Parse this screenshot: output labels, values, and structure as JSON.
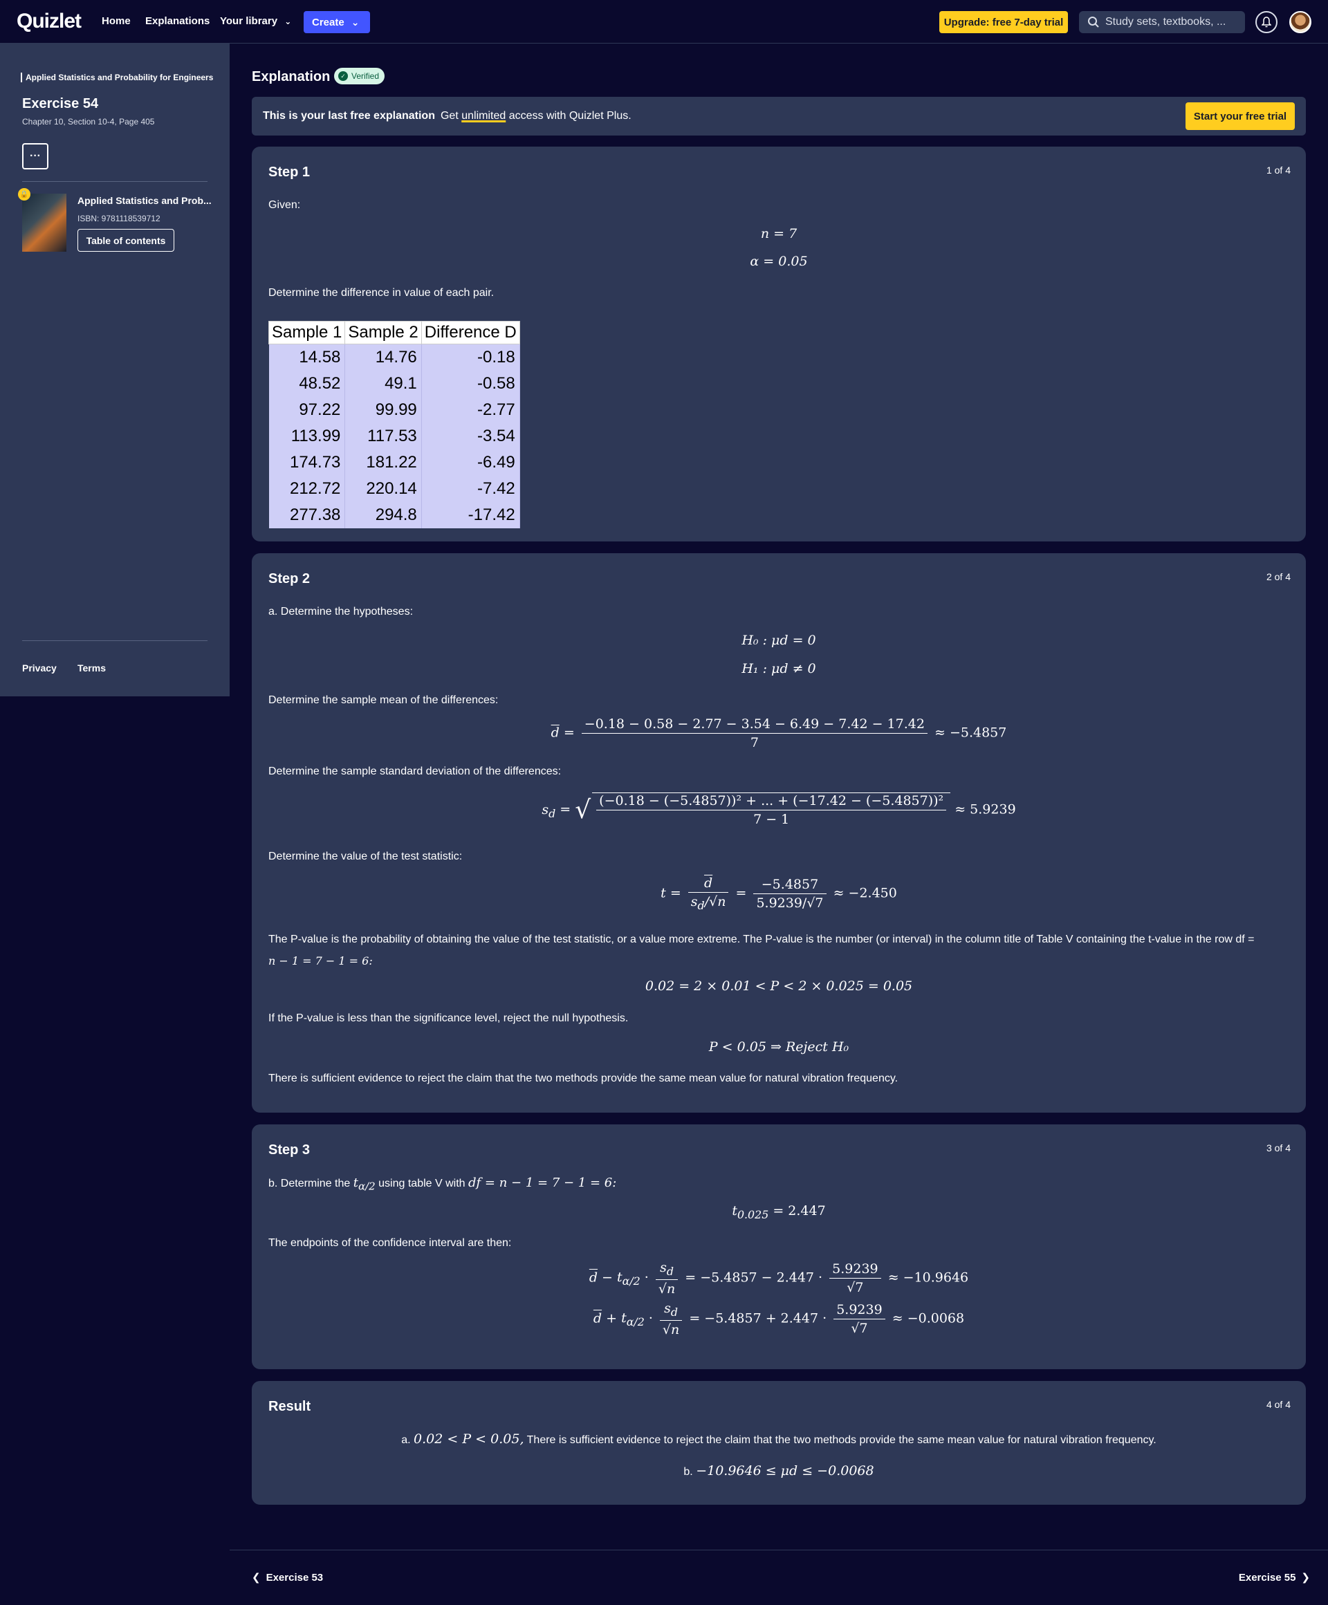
{
  "topbar": {
    "logo": "Quizlet",
    "nav": [
      "Home",
      "Explanations",
      "Your library"
    ],
    "create": "Create",
    "upgrade": "Upgrade: free 7-day trial",
    "search_placeholder": "Study sets, textbooks, ..."
  },
  "sidebar": {
    "book": "Applied Statistics and Probability for Engineers",
    "exercise": "Exercise 54",
    "chapter": "Chapter 10, Section 10-4, Page 405",
    "more": "···",
    "book_short": "Applied Statistics and Prob...",
    "isbn": "ISBN: 9781118539712",
    "toc": "Table of contents",
    "privacy": "Privacy",
    "terms": "Terms"
  },
  "main": {
    "title": "Explanation",
    "verified": "Verified",
    "banner_bold": "This is your last free explanation",
    "banner_pre": "Get",
    "banner_under": "unlimited",
    "banner_post": "access with Quizlet Plus.",
    "trial": "Start your free trial"
  },
  "step1": {
    "title": "Step 1",
    "count": "1 of 4",
    "given": "Given:",
    "n": "n = 7",
    "alpha": "α = 0.05",
    "determine": "Determine the difference in value of each pair.",
    "headers": [
      "Sample 1",
      "Sample 2",
      "Difference D"
    ],
    "rows": [
      [
        "14.58",
        "14.76",
        "-0.18"
      ],
      [
        "48.52",
        "49.1",
        "-0.58"
      ],
      [
        "97.22",
        "99.99",
        "-2.77"
      ],
      [
        "113.99",
        "117.53",
        "-3.54"
      ],
      [
        "174.73",
        "181.22",
        "-6.49"
      ],
      [
        "212.72",
        "220.14",
        "-7.42"
      ],
      [
        "277.38",
        "294.8",
        "-17.42"
      ]
    ]
  },
  "step2": {
    "title": "Step 2",
    "count": "2 of 4",
    "a": "a. Determine the hypotheses:",
    "h0": "H₀ : μd = 0",
    "h1": "H₁ : μd ≠ 0",
    "mean_text": "Determine the sample mean of the differences:",
    "mean_num": "−0.18 − 0.58 − 2.77 − 3.54 − 6.49 − 7.42 − 17.42",
    "mean_den": "7",
    "mean_res": "≈ −5.4857",
    "sd_text": "Determine the sample standard deviation of the differences:",
    "sd_num": "(−0.18 − (−5.4857))² + ... + (−17.42 − (−5.4857))²",
    "sd_den": "7 − 1",
    "sd_res": "≈ 5.9239",
    "t_text": "Determine the value of the test statistic:",
    "t_num2": "−5.4857",
    "t_den2": "5.9239/√7",
    "t_res": "≈ −2.450",
    "p_text1": "The P-value is the probability of obtaining the value of the test statistic, or a value more extreme. The P-value is the number (or interval) in the column title of Table V containing the t-value in the row df =",
    "p_text2": "n − 1 = 7 − 1 = 6:",
    "p_eq": "0.02 = 2 × 0.01 < P < 2 × 0.025 = 0.05",
    "reject_text": "If the P-value is less than the significance level, reject the null hypothesis.",
    "reject_eq": "P < 0.05 ⇒  Reject H₀",
    "conclusion": "There is sufficient evidence to reject the claim that the two methods provide the same mean value for natural vibration frequency."
  },
  "step3": {
    "title": "Step 3",
    "count": "3 of 4",
    "b_pre": "b. Determine the",
    "b_mid": "using table V with",
    "b_post": "df = n − 1 = 7 − 1 = 6:",
    "t_eq": "= 2.447",
    "ci_text": "The endpoints of the confidence interval are then:",
    "ci1_mid": "= −5.4857 − 2.447 ·",
    "ci1_res": "≈ −10.9646",
    "ci2_mid": "= −5.4857 + 2.447 ·",
    "ci2_res": "≈ −0.0068",
    "frac_num": "5.9239",
    "frac_den": "√7"
  },
  "result": {
    "title": "Result",
    "count": "4 of 4",
    "a_pre": "a.",
    "a_eq": "0.02 < P < 0.05,",
    "a_text": "There is sufficient evidence to reject the claim that the two methods provide the same mean value for natural vibration frequency.",
    "b_pre": "b.",
    "b_eq": "−10.9646 ≤ μd ≤ −0.0068"
  },
  "footer": {
    "prev": "Exercise 53",
    "next": "Exercise 55"
  },
  "colors": {
    "background": "#0a092d",
    "card": "#2e3856",
    "accent": "#4255ff",
    "yellow": "#ffcd1f"
  }
}
